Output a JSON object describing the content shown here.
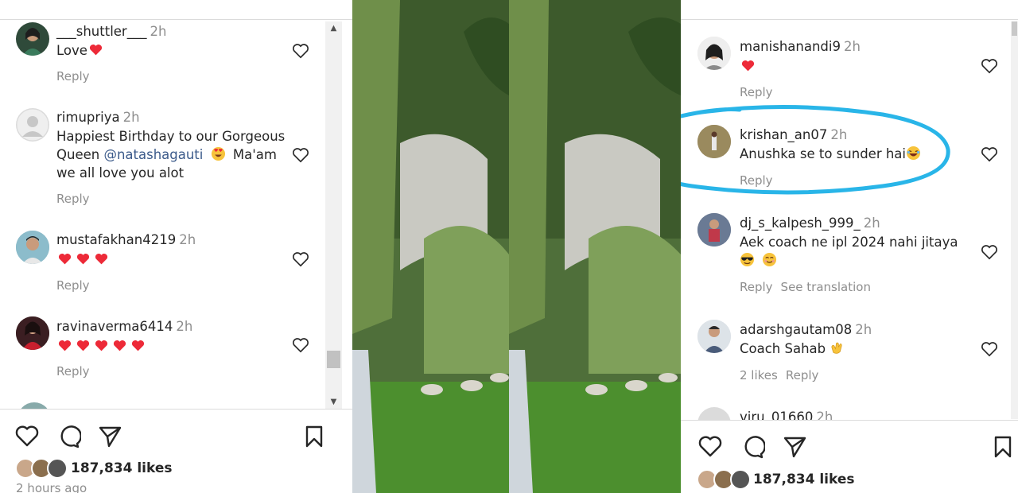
{
  "left": {
    "comments": [
      {
        "username": "___shuttler___",
        "time": "2h",
        "text": "Love",
        "hearts": 1,
        "reply": "Reply"
      },
      {
        "username": "rimupriya",
        "time": "2h",
        "text_line1": "Happiest Birthday to our Gorgeous",
        "text_line2_prefix": "Queen ",
        "mention": "@natashagauti",
        "text_line2_suffix": "Ma'am",
        "text_line3": "we all love you alot",
        "reply": "Reply"
      },
      {
        "username": "mustafakhan4219",
        "time": "2h",
        "hearts": 3,
        "reply": "Reply"
      },
      {
        "username": "ravinaverma6414",
        "time": "2h",
        "hearts": 5,
        "reply": "Reply"
      }
    ],
    "likes": "187,834 likes",
    "posted": "2 hours ago"
  },
  "right": {
    "comments": [
      {
        "username": "manishanandi9",
        "time": "2h",
        "hearts": 1,
        "reply": "Reply"
      },
      {
        "username": "krishan_an07",
        "time": "2h",
        "text": "Anushka se to sunder hai",
        "reply": "Reply"
      },
      {
        "username": "dj_s_kalpesh_999_",
        "time": "2h",
        "text": "Aek coach ne ipl 2024 nahi jitaya",
        "reply": "Reply",
        "translate": "See translation"
      },
      {
        "username": "adarshgautam08",
        "time": "2h",
        "text": "Coach Sahab",
        "likes": "2 likes",
        "reply": "Reply"
      },
      {
        "username": "viru_01660",
        "time": "2h"
      }
    ],
    "likes": "187,834 likes"
  },
  "icons": [
    "heart-icon",
    "comment-icon",
    "share-icon",
    "bookmark-icon",
    "heart-eyes-emoji",
    "laughing-emoji",
    "sunglasses-emoji",
    "smile-emoji",
    "clapping-emoji"
  ],
  "colors": {
    "like_heart": "#ed2a38",
    "highlight_circle": "#29b5e8",
    "mention": "#3b5a8a",
    "muted": "#8e8e8e"
  }
}
